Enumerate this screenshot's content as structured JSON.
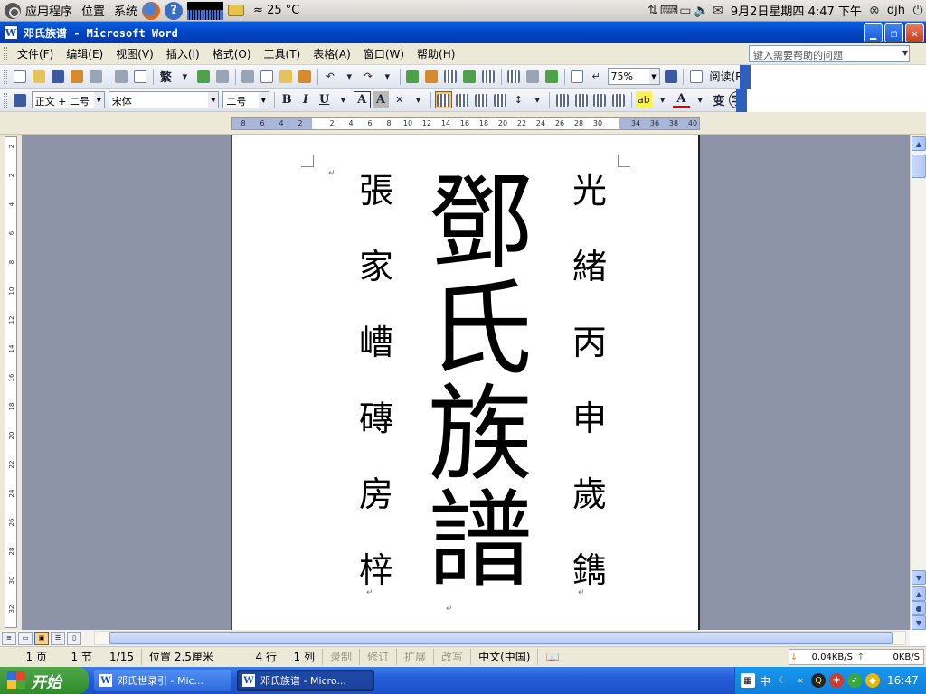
{
  "top_panel": {
    "menus": [
      "应用程序",
      "位置",
      "系统"
    ],
    "weather": "≈ 25 °C",
    "datetime": "9月2日星期四  4:47 下午",
    "user": "djh"
  },
  "window": {
    "title": "邓氏族谱 - Microsoft Word",
    "icon_letter": "W"
  },
  "menubar": {
    "items": [
      "文件(F)",
      "编辑(E)",
      "视图(V)",
      "插入(I)",
      "格式(O)",
      "工具(T)",
      "表格(A)",
      "窗口(W)",
      "帮助(H)"
    ],
    "help_placeholder": "键入需要帮助的问题"
  },
  "toolbar": {
    "traditional": "繁",
    "zoom": "75%",
    "reading": "阅读(R)"
  },
  "format_toolbar": {
    "style": "正文 + 二号",
    "font": "宋体",
    "size": "二号",
    "bold": "B",
    "italic": "I",
    "underline": "U",
    "char_border": "A",
    "char_shade": "A",
    "font_color": "A",
    "phonetic": "变",
    "enclose": "字"
  },
  "ruler": {
    "ticks": [
      "8",
      "6",
      "4",
      "2",
      "2",
      "4",
      "6",
      "8",
      "10",
      "12",
      "14",
      "16",
      "18",
      "20",
      "22",
      "24",
      "26",
      "28",
      "30",
      "34",
      "36",
      "38",
      "40"
    ],
    "vticks": [
      "2",
      "2",
      "4",
      "6",
      "8",
      "10",
      "12",
      "14",
      "16",
      "18",
      "20",
      "22",
      "24",
      "26",
      "28",
      "30",
      "32"
    ]
  },
  "document": {
    "title_chars": [
      "鄧",
      "氏",
      "族",
      "譜"
    ],
    "left_chars": [
      "張",
      "家",
      "嶆",
      "磚",
      "房",
      "梓"
    ],
    "right_chars": [
      "光",
      "緒",
      "丙",
      "申",
      "歲",
      "鐫"
    ],
    "para_mark": "↵"
  },
  "statusbar": {
    "page": "1 页",
    "section": "1 节",
    "pages": "1/15",
    "position": "位置 2.5厘米",
    "line": "4 行",
    "column": "1 列",
    "rec": "录制",
    "trk": "修订",
    "ext": "扩展",
    "ovr": "改写",
    "lang": "中文(中国)",
    "net_down": "0.04KB/S",
    "net_up": "0KB/S"
  },
  "taskbar": {
    "start": "开始",
    "tasks": [
      "邓氏世录引 - Mic...",
      "邓氏族谱 - Micro..."
    ],
    "ime": "中",
    "clock": "16:47"
  },
  "colors": {
    "title_blue": "#0144c5",
    "taskbar_blue": "#245ed8",
    "start_green": "#3a982f",
    "doc_bg": "#8d94a8"
  }
}
